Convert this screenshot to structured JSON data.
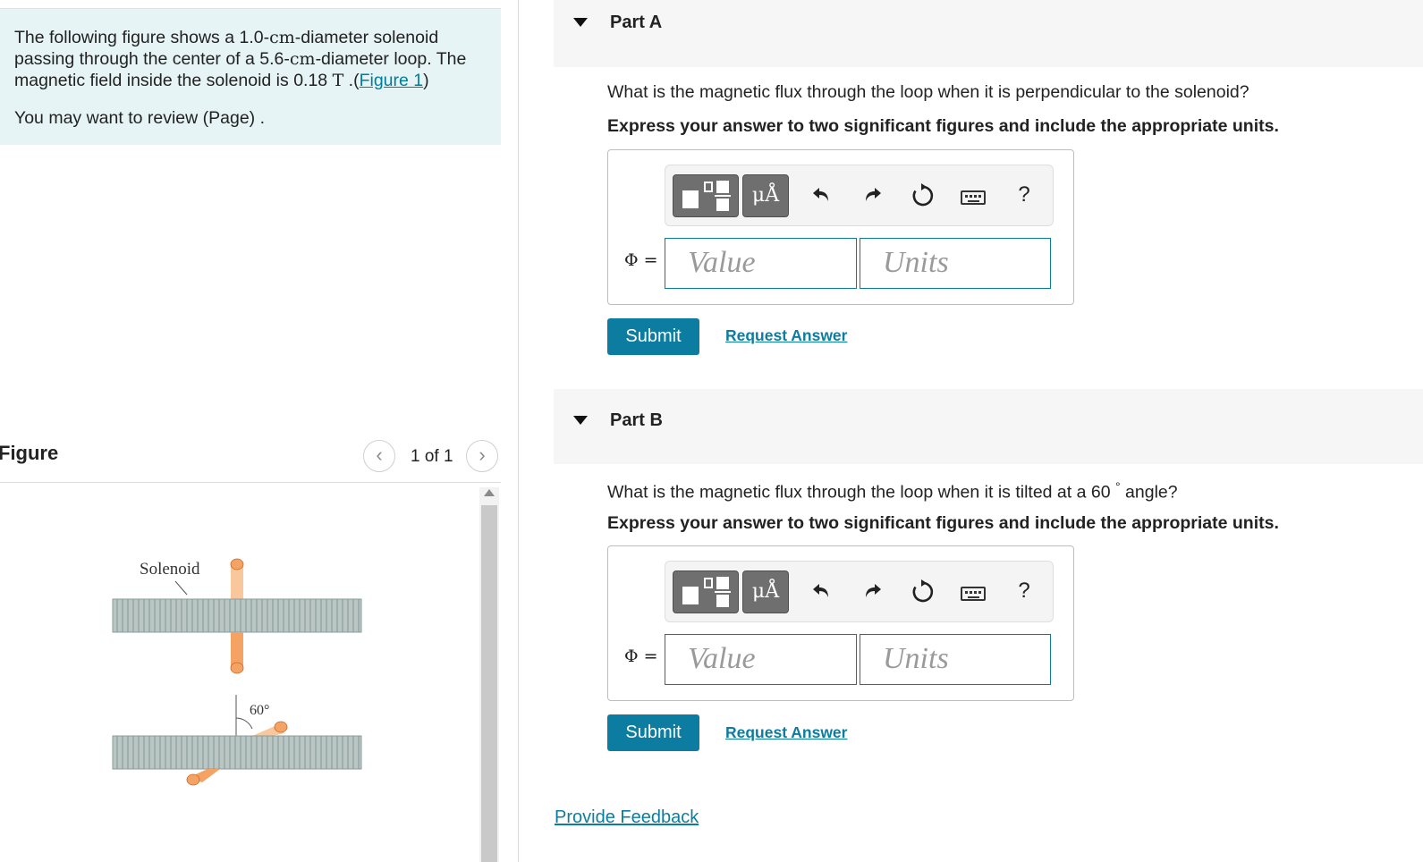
{
  "intro": {
    "text_before_d1": "The following figure shows a ",
    "d1_value": "1.0",
    "d1_unit": "cm",
    "text_between": "-diameter solenoid passing through the center of a ",
    "d2_value": "5.6",
    "d2_unit": "cm",
    "text_after_d2": "-diameter loop. The magnetic field inside the solenoid is ",
    "field_value": "0.18",
    "field_unit": "T",
    "figure_link_prefix": " .(",
    "figure_link": "Figure 1",
    "figure_link_suffix": ")",
    "review_text": "You may want to review (Page) ."
  },
  "figure_panel": {
    "title": "Figure",
    "prev_icon": "‹",
    "next_icon": "›",
    "page_indicator": "1 of 1",
    "solenoid_label": "Solenoid",
    "angle_label": "60°",
    "colors": {
      "solenoid_fill": "#b9c6c4",
      "loop_fill": "#f5a364",
      "loop_light": "#f8c79c"
    }
  },
  "parts": [
    {
      "title": "Part A",
      "question": "What is the magnetic flux through the loop when it is perpendicular to the solenoid?",
      "instruction": "Express your answer to two significant figures and include the appropriate units.",
      "toolbar": {
        "units_label": "μÅ",
        "undo_icon": "undo-icon",
        "redo_icon": "redo-icon",
        "reset_icon": "reset-icon",
        "keyboard_icon": "keyboard-icon",
        "help_label": "?"
      },
      "variable_label": "Φ =",
      "value_placeholder": "Value",
      "units_placeholder": "Units",
      "submit_label": "Submit",
      "request_label": "Request Answer"
    },
    {
      "title": "Part B",
      "question_prefix": "What is the magnetic flux through the loop when it is tilted at a ",
      "question_angle": "60",
      "question_degree": "°",
      "question_suffix": " angle?",
      "instruction": "Express your answer to two significant figures and include the appropriate units.",
      "toolbar": {
        "units_label": "μÅ",
        "undo_icon": "undo-icon",
        "redo_icon": "redo-icon",
        "reset_icon": "reset-icon",
        "keyboard_icon": "keyboard-icon",
        "help_label": "?"
      },
      "variable_label": "Φ =",
      "value_placeholder": "Value",
      "units_placeholder": "Units",
      "submit_label": "Submit",
      "request_label": "Request Answer"
    }
  ],
  "feedback_link": "Provide Feedback",
  "colors": {
    "accent": "#0c7da0",
    "intro_bg": "#e6f4f5",
    "header_bg": "#f6f6f6"
  }
}
